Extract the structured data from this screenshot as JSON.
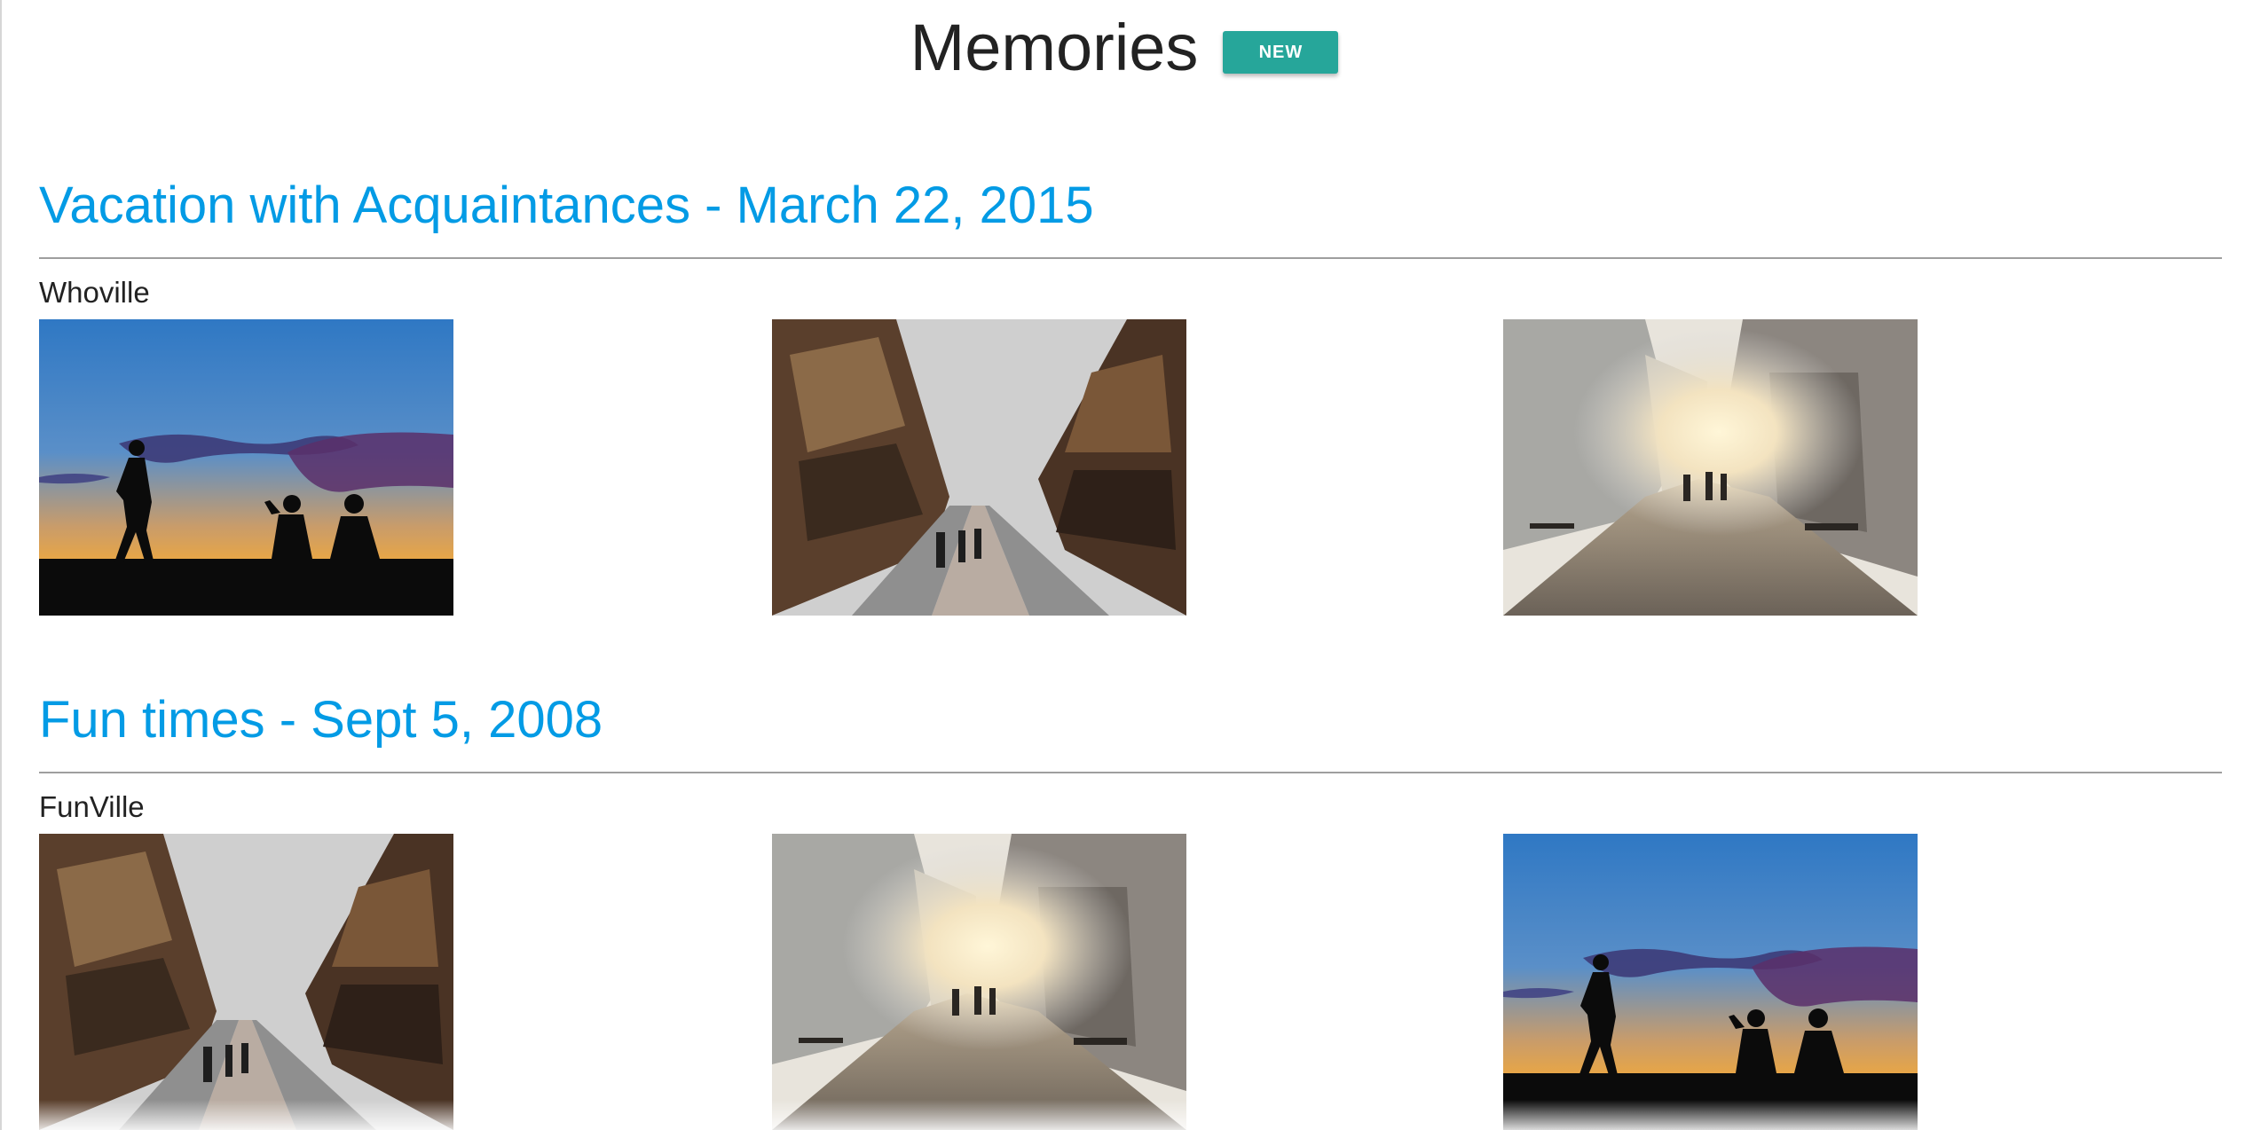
{
  "header": {
    "title": "Memories",
    "new_button_label": "NEW"
  },
  "colors": {
    "accent": "#039be5",
    "new_button": "#26a69a",
    "divider": "#9e9e9e"
  },
  "memories": [
    {
      "title": "Vacation with Acquaintances - March 22, 2015",
      "location": "Whoville",
      "photos": [
        {
          "subject": "silhouettes-at-sunset"
        },
        {
          "subject": "traditional-japanese-street"
        },
        {
          "subject": "cobblestone-street-sunset"
        }
      ]
    },
    {
      "title": "Fun times - Sept 5, 2008",
      "location": "FunVille",
      "photos": [
        {
          "subject": "traditional-japanese-street"
        },
        {
          "subject": "cobblestone-street-sunset"
        },
        {
          "subject": "silhouettes-at-sunset"
        }
      ]
    }
  ]
}
